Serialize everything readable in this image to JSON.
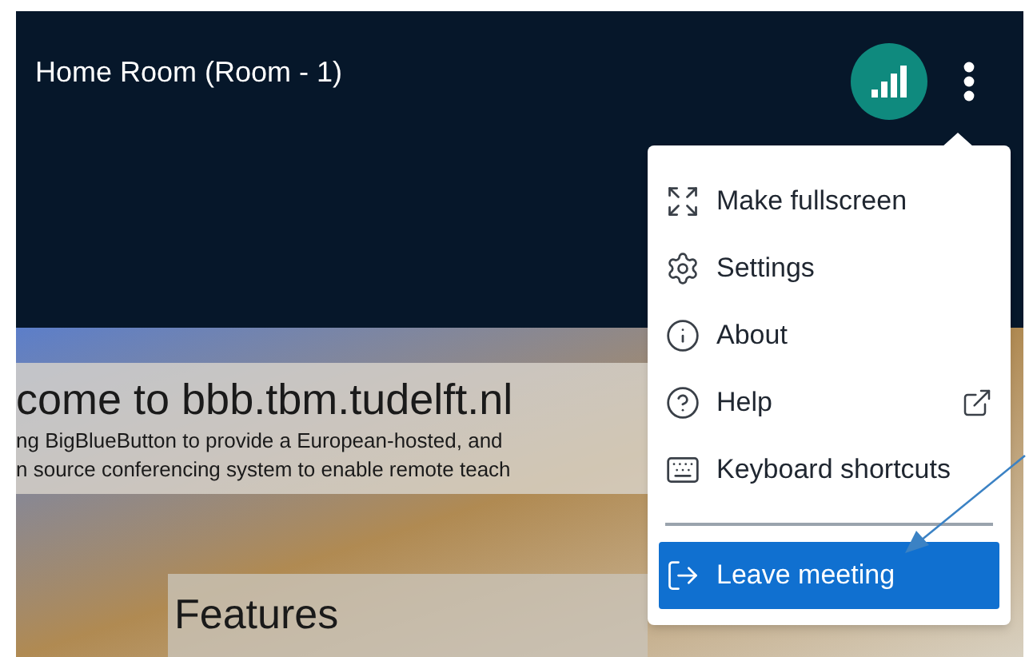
{
  "header": {
    "title": "Home Room (Room - 1)"
  },
  "slide": {
    "title": "come to bbb.tbm.tudelft.nl",
    "lines": [
      "ng BigBlueButton to provide a European-hosted, and",
      "n source conferencing system to enable remote teach"
    ],
    "heading": "Features"
  },
  "menu": {
    "items": [
      {
        "kind": "fullscreen",
        "label": "Make fullscreen",
        "external": false,
        "selected": false
      },
      {
        "kind": "settings",
        "label": "Settings",
        "external": false,
        "selected": false
      },
      {
        "kind": "about",
        "label": "About",
        "external": false,
        "selected": false
      },
      {
        "kind": "help",
        "label": "Help",
        "external": true,
        "selected": false
      },
      {
        "kind": "shortcuts",
        "label": "Keyboard shortcuts",
        "external": false,
        "selected": false
      },
      {
        "kind": "leave",
        "label": "Leave meeting",
        "external": false,
        "selected": true
      }
    ]
  }
}
